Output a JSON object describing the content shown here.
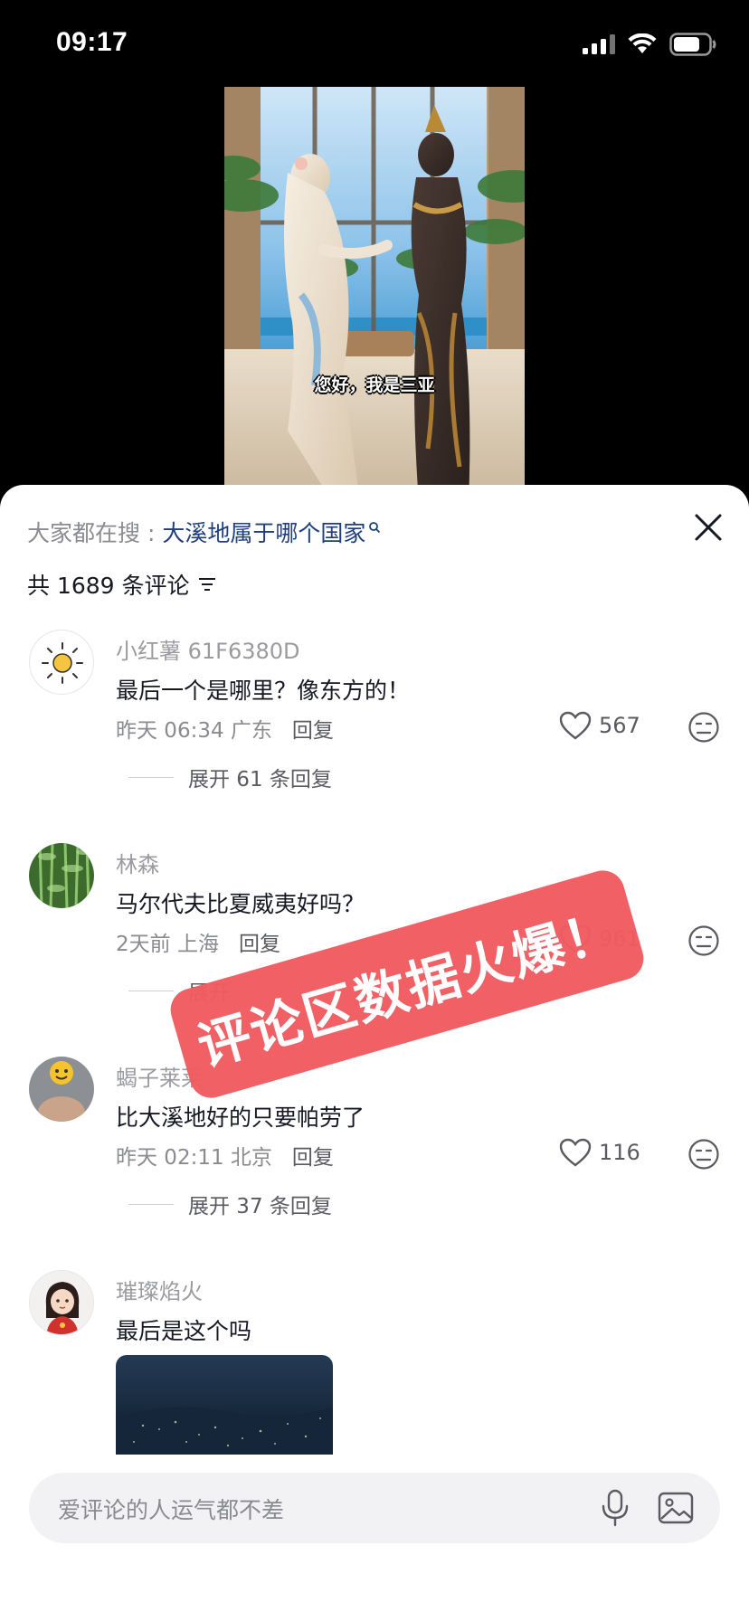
{
  "status_bar": {
    "time": "09:17"
  },
  "video": {
    "caption": "您好，我是三亚"
  },
  "search_hint": {
    "prefix": "大家都在搜 : ",
    "term": "大溪地属于哪个国家"
  },
  "comment_count": "共 1689 条评论",
  "comments": [
    {
      "user": "小红薯 61F6380D",
      "text": "最后一个是哪里？像东方的！",
      "time": "昨天 06:34 广东",
      "reply": "回复",
      "likes": "567",
      "expand": "展开 61 条回复"
    },
    {
      "user": "林森",
      "text": "马尔代夫比夏威夷好吗？",
      "time": "2天前 上海",
      "reply": "回复",
      "likes": "961",
      "expand": "展开"
    },
    {
      "user": "蝎子莱莱",
      "text": "比大溪地好的只要帕劳了",
      "time": "昨天 02:11 北京",
      "reply": "回复",
      "likes": "116",
      "expand": "展开 37 条回复"
    },
    {
      "user": "璀璨焰火",
      "text": "最后是这个吗"
    }
  ],
  "promo_stamp": "评论区数据火爆！",
  "input": {
    "placeholder": "爱评论的人运气都不差"
  },
  "colors": {
    "accent_link": "#1f3f7a",
    "stamp": "#f05b5f"
  }
}
